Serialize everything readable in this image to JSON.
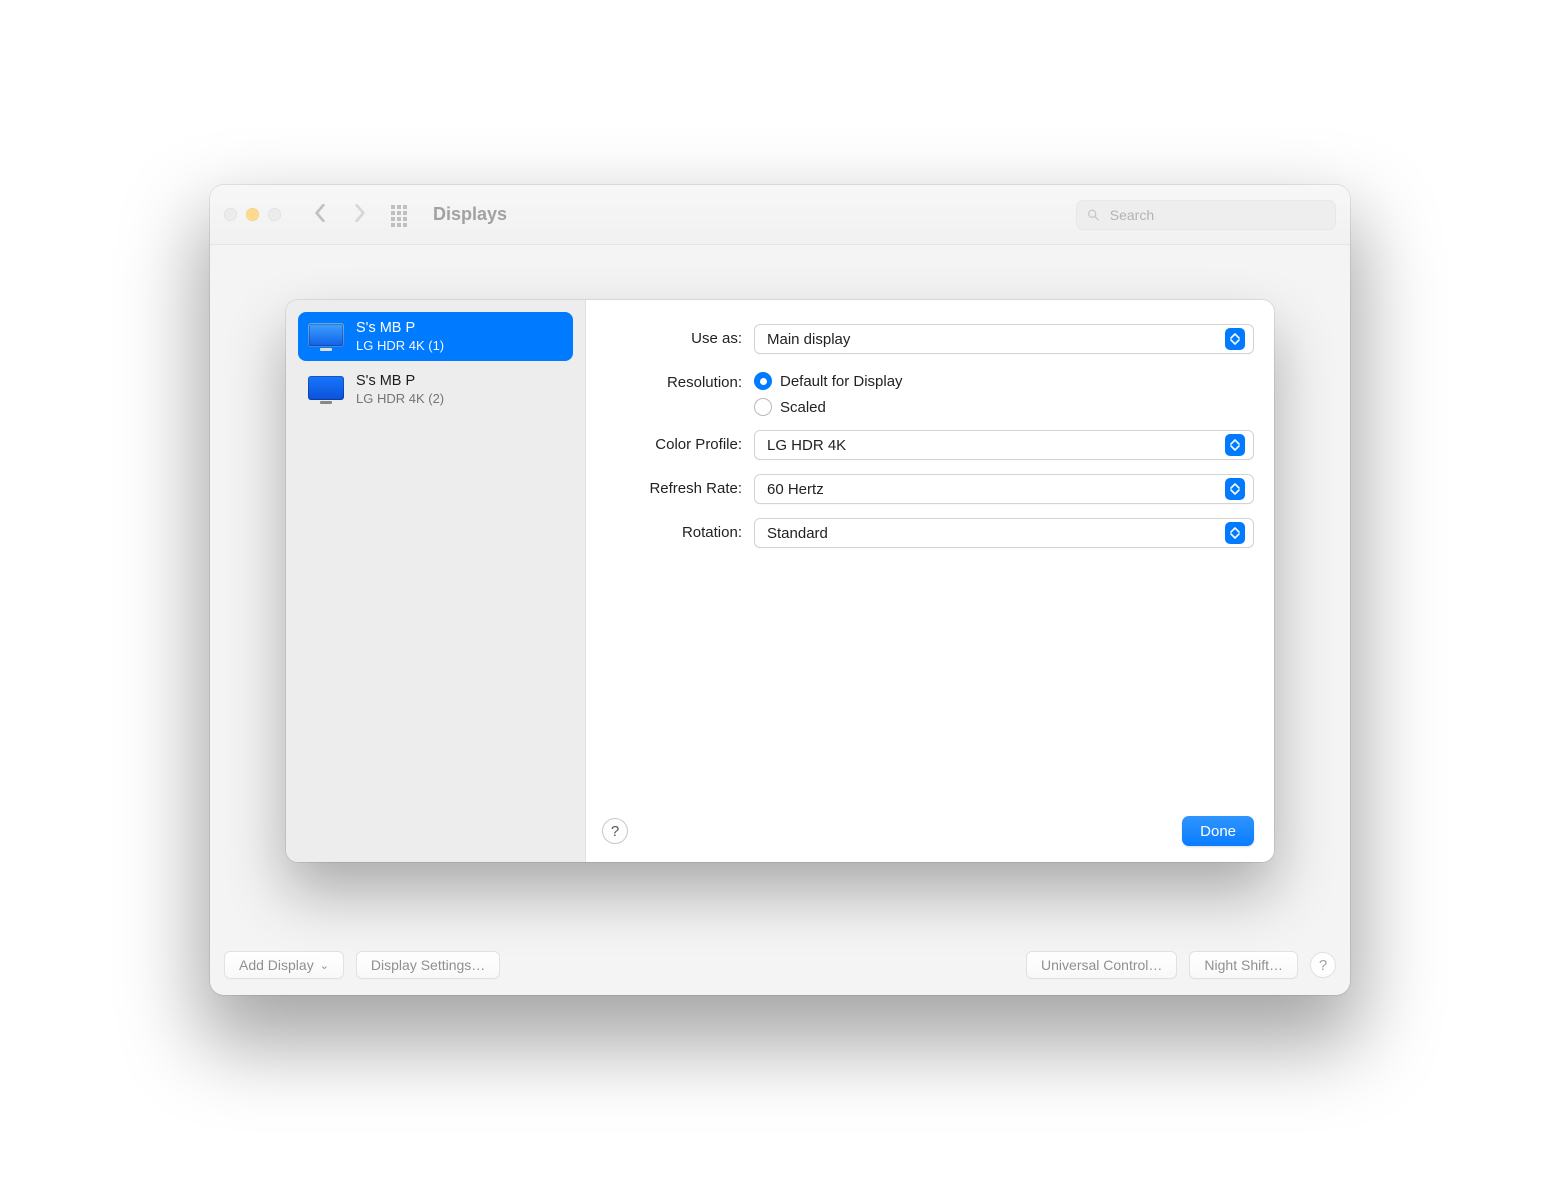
{
  "window": {
    "title": "Displays",
    "search_placeholder": "Search"
  },
  "bottom": {
    "add_display": "Add Display",
    "display_settings": "Display Settings…",
    "universal_control": "Universal Control…",
    "night_shift": "Night Shift…"
  },
  "sheet": {
    "displays": [
      {
        "name": "S's MB P",
        "sub": "LG HDR 4K (1)",
        "selected": true
      },
      {
        "name": "S's MB P",
        "sub": "LG HDR 4K (2)",
        "selected": false
      }
    ],
    "labels": {
      "use_as": "Use as:",
      "resolution": "Resolution:",
      "color_profile": "Color Profile:",
      "refresh_rate": "Refresh Rate:",
      "rotation": "Rotation:"
    },
    "use_as_value": "Main display",
    "resolution_default": "Default for Display",
    "resolution_scaled": "Scaled",
    "resolution_selected": "default",
    "color_profile_value": "LG HDR 4K",
    "refresh_rate_value": "60 Hertz",
    "rotation_value": "Standard",
    "done": "Done",
    "help": "?"
  }
}
